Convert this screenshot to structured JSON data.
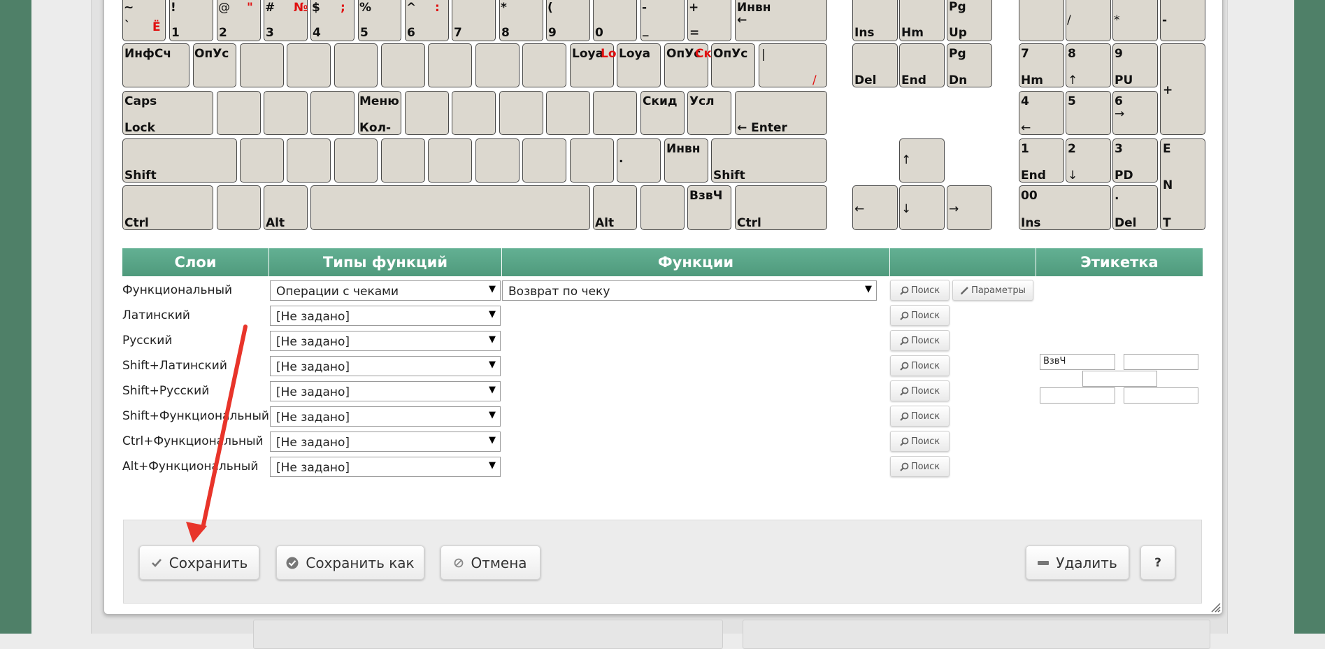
{
  "keyboard": {
    "row1": {
      "tilde": {
        "top": "~",
        "bottom": "`",
        "red": "Ё"
      },
      "k1": {
        "top": "!",
        "bottom": "1"
      },
      "k2": {
        "top": "@",
        "red": "\"",
        "bottom": "2"
      },
      "k3": {
        "top": "#",
        "red": "№",
        "bottom": "3"
      },
      "k4": {
        "top": "$",
        "red": ";",
        "bottom": "4"
      },
      "k5": {
        "top": "%",
        "bottom": "5"
      },
      "k6": {
        "top": "^",
        "red": ":",
        "bottom": "6"
      },
      "k7": {
        "bottom": "7"
      },
      "k8": {
        "top": "*",
        "bottom": "8"
      },
      "k9": {
        "top": "(",
        "bottom": "9"
      },
      "k0": {
        "bottom": "0"
      },
      "minus": {
        "top": "-",
        "bottom": "_"
      },
      "equal": {
        "top": "+",
        "bottom": "="
      },
      "backspace": {
        "top": "Инвн",
        "bottom": "←"
      },
      "ins": "Ins",
      "hm": "Hm",
      "pgup": {
        "top": "Pg",
        "bottom": "Up"
      },
      "np_slash": "/",
      "np_star": "*",
      "np_minus": "-"
    },
    "row2": {
      "tab": "ИнфСч",
      "q": "ОпУс",
      "lb1": "Loya",
      "lb1_red": "Lo",
      "lb2": "Loya",
      "lb3": "ОпУс",
      "lb3_red": "Ск",
      "lb4": "ОпУс",
      "backslash": {
        "top": "|",
        "red": "/"
      },
      "del": "Del",
      "end": "End",
      "pgdn": {
        "top": "Pg",
        "bottom": "Dn"
      },
      "np7": {
        "top": "7",
        "bottom": "Hm"
      },
      "np8": {
        "top": "8",
        "bottom": "↑"
      },
      "np9": {
        "top": "9",
        "bottom": "PU"
      },
      "np_plus": "+"
    },
    "row3": {
      "caps": {
        "top": "Caps",
        "bottom": "Lock"
      },
      "menu": {
        "top": "Меню",
        "bottom": "Кол-"
      },
      "skid": "Скид",
      "usl": "Усл",
      "enter": "← Enter",
      "np4": {
        "top": "4",
        "bottom": "←"
      },
      "np5": "5",
      "np6": {
        "top": "6",
        "bottom": "→"
      }
    },
    "row4": {
      "lshift": "Shift",
      "dot": ".",
      "invn": "Инвн",
      "rshift": "Shift",
      "up": "↑",
      "np1": {
        "top": "1",
        "bottom": "End"
      },
      "np2": {
        "top": "2",
        "bottom": "↓"
      },
      "np3": {
        "top": "3",
        "bottom": "PD"
      },
      "np_enter": {
        "top": "E",
        "mid": "N",
        "bottom": "T"
      }
    },
    "row5": {
      "lctrl": "Ctrl",
      "alt": "Alt",
      "ralt": "Alt",
      "vzvch": "ВзвЧ",
      "rctrl": "Ctrl",
      "left": "←",
      "down": "↓",
      "right": "→",
      "np0": {
        "top": "00",
        "bottom": "Ins"
      },
      "npdot": {
        "top": ".",
        "bottom": "Del"
      }
    }
  },
  "table": {
    "headers": {
      "layers": "Слои",
      "types": "Типы функций",
      "functions": "Функции",
      "empty": "",
      "label": "Этикетка"
    },
    "rows": [
      {
        "layer": "Функциональный",
        "type": "Операции с чеками",
        "function": "Возврат по чеку"
      },
      {
        "layer": "Латинский",
        "type": "[Не задано]"
      },
      {
        "layer": "Русский",
        "type": "[Не задано]"
      },
      {
        "layer": "Shift+Латинский",
        "type": "[Не задано]"
      },
      {
        "layer": "Shift+Русский",
        "type": "[Не задано]"
      },
      {
        "layer": "Shift+Функциональный",
        "type": "[Не задано]"
      },
      {
        "layer": "Ctrl+Функциональный",
        "type": "[Не задано]"
      },
      {
        "layer": "Alt+Функциональный",
        "type": "[Не задано]"
      }
    ],
    "search_label": "Поиск",
    "params_label": "Параметры",
    "label_inputs": {
      "top_left": "ВзвЧ",
      "top_right": "",
      "middle": "",
      "bottom_left": "",
      "bottom_right": ""
    }
  },
  "footer": {
    "save": "Сохранить",
    "save_as": "Сохранить как",
    "cancel": "Отмена",
    "delete": "Удалить",
    "help": "?"
  },
  "colors": {
    "header_green": "#5aa888",
    "side_green": "#4f8068",
    "key_fill": "#dcd8cf",
    "red_label": "#e01010",
    "annotation_arrow": "#e8342a"
  }
}
